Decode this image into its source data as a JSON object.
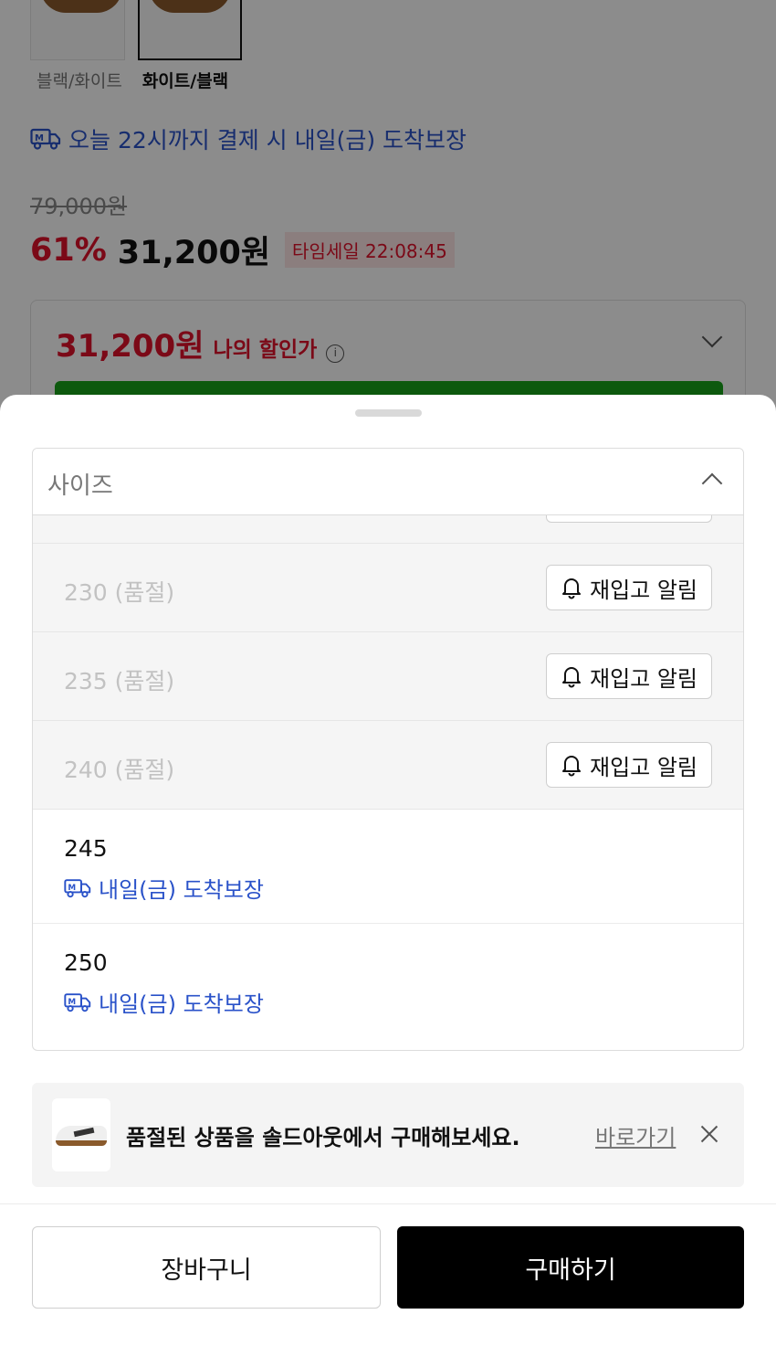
{
  "product": {
    "colors": [
      {
        "label": "블랙/화이트",
        "selected": false
      },
      {
        "label": "화이트/블랙",
        "selected": true
      }
    ],
    "delivery_notice": "오늘 22시까지 결제 시 내일(금) 도착보장",
    "original_price": "79,000원",
    "discount_rate": "61%",
    "sale_price": "31,200원",
    "timesale_label": "타임세일 22:08:45",
    "my_price": {
      "amount": "31,200원",
      "label": "나의 할인가",
      "info_icon": "i"
    }
  },
  "colors_theme": {
    "accent_red": "#e0112b",
    "delivery_blue": "#2a52c9",
    "buy_button": "#000000",
    "green_bar": "#19a31b"
  },
  "sheet": {
    "dropdown_title": "사이즈",
    "sizes_soldout": [
      {
        "label": "230 (품절)",
        "button": "재입고 알림"
      },
      {
        "label": "235 (품절)",
        "button": "재입고 알림"
      },
      {
        "label": "240 (품절)",
        "button": "재입고 알림"
      }
    ],
    "sizes_available": [
      {
        "label": "245",
        "delivery": "내일(금) 도착보장"
      },
      {
        "label": "250",
        "delivery": "내일(금) 도착보장"
      }
    ],
    "banner": {
      "text": "품절된 상품을 솔드아웃에서 구매해보세요.",
      "link": "바로가기"
    },
    "cart_button": "장바구니",
    "buy_button": "구매하기"
  }
}
